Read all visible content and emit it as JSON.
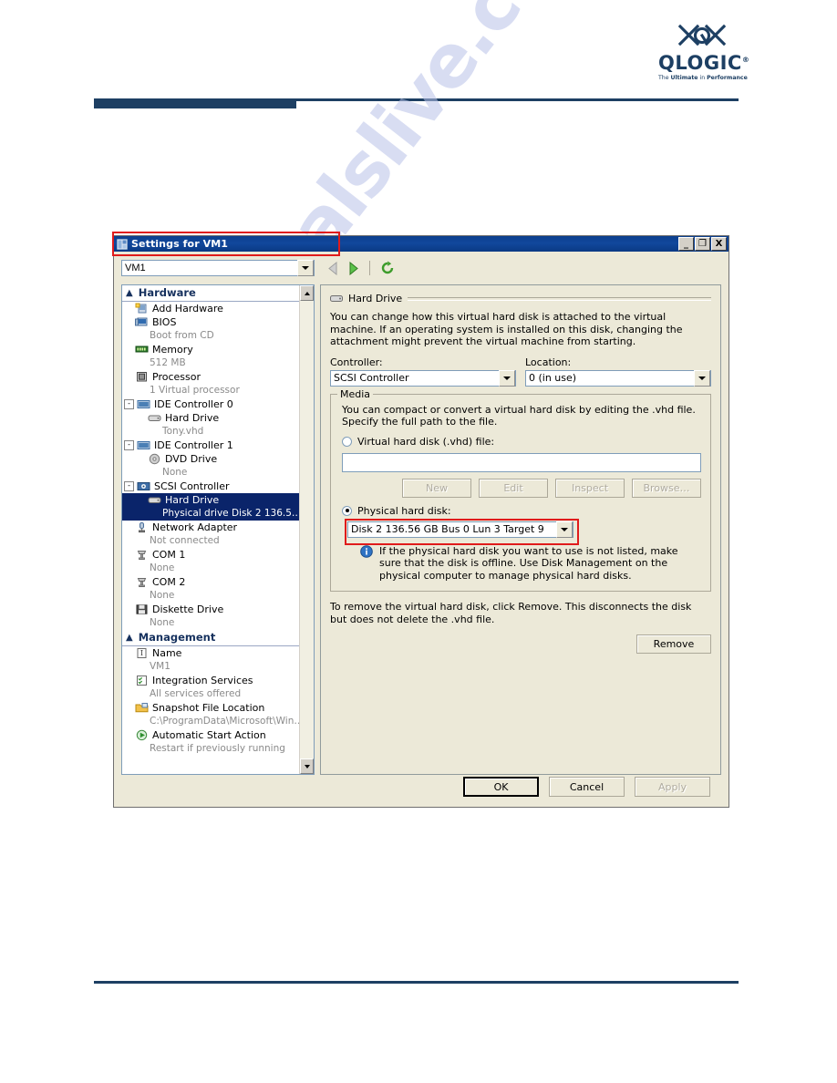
{
  "brand": {
    "logo_name": "qlogic-logo",
    "wordmark": "QLOGIC",
    "registered": "®",
    "tagline_pre": "The",
    "tagline_bold": "Ultimate",
    "tagline_mid": "in",
    "tagline_bold2": "Performance",
    "accent_color": "#1d3f63"
  },
  "watermark": {
    "text": "manualslive.com",
    "color": "#b9c2e8"
  },
  "dialog": {
    "title": "Settings for VM1",
    "window_buttons": [
      {
        "name": "minimize-button",
        "glyph": "_"
      },
      {
        "name": "maximize-button",
        "glyph": "❐"
      },
      {
        "name": "close-button",
        "glyph": "X"
      }
    ],
    "vm_selector": {
      "value": "VM1"
    },
    "toolbar": {
      "back_icon": "back-arrow-icon",
      "forward_icon": "forward-arrow-icon",
      "refresh_icon": "refresh-icon"
    }
  },
  "tree": {
    "groups": [
      {
        "label": "Hardware",
        "nodes": [
          {
            "icon": "add-hardware-icon",
            "label": "Add Hardware",
            "sub": null,
            "expander": null,
            "indent": false,
            "selected": false
          },
          {
            "icon": "bios-icon",
            "label": "BIOS",
            "sub": "Boot from CD",
            "expander": null,
            "indent": false,
            "selected": false
          },
          {
            "icon": "memory-icon",
            "label": "Memory",
            "sub": "512 MB",
            "expander": null,
            "indent": false,
            "selected": false
          },
          {
            "icon": "processor-icon",
            "label": "Processor",
            "sub": "1 Virtual processor",
            "expander": null,
            "indent": false,
            "selected": false
          },
          {
            "icon": "ide-controller-icon",
            "label": "IDE Controller 0",
            "sub": null,
            "expander": "-",
            "indent": false,
            "selected": false
          },
          {
            "icon": "hard-drive-icon",
            "label": "Hard Drive",
            "sub": "Tony.vhd",
            "expander": null,
            "indent": true,
            "selected": false
          },
          {
            "icon": "ide-controller-icon",
            "label": "IDE Controller 1",
            "sub": null,
            "expander": "-",
            "indent": false,
            "selected": false
          },
          {
            "icon": "dvd-drive-icon",
            "label": "DVD Drive",
            "sub": "None",
            "expander": null,
            "indent": true,
            "selected": false
          },
          {
            "icon": "scsi-controller-icon",
            "label": "SCSI Controller",
            "sub": null,
            "expander": "-",
            "indent": false,
            "selected": false
          },
          {
            "icon": "hard-drive-icon",
            "label": "Hard Drive",
            "sub": "Physical drive Disk 2 136.5…",
            "expander": null,
            "indent": true,
            "selected": true
          },
          {
            "icon": "network-adapter-icon",
            "label": "Network Adapter",
            "sub": "Not connected",
            "expander": null,
            "indent": false,
            "selected": false
          },
          {
            "icon": "com-port-icon",
            "label": "COM 1",
            "sub": "None",
            "expander": null,
            "indent": false,
            "selected": false
          },
          {
            "icon": "com-port-icon",
            "label": "COM 2",
            "sub": "None",
            "expander": null,
            "indent": false,
            "selected": false
          },
          {
            "icon": "diskette-drive-icon",
            "label": "Diskette Drive",
            "sub": "None",
            "expander": null,
            "indent": false,
            "selected": false
          }
        ]
      },
      {
        "label": "Management",
        "nodes": [
          {
            "icon": "name-icon",
            "label": "Name",
            "sub": "VM1",
            "expander": null,
            "indent": false,
            "selected": false
          },
          {
            "icon": "integration-services-icon",
            "label": "Integration Services",
            "sub": "All services offered",
            "expander": null,
            "indent": false,
            "selected": false
          },
          {
            "icon": "snapshot-folder-icon",
            "label": "Snapshot File Location",
            "sub": "C:\\ProgramData\\Microsoft\\Win…",
            "expander": null,
            "indent": false,
            "selected": false
          },
          {
            "icon": "automatic-start-icon",
            "label": "Automatic Start Action",
            "sub": "Restart if previously running",
            "expander": null,
            "indent": false,
            "selected": false
          }
        ]
      }
    ]
  },
  "detail": {
    "section_title": "Hard Drive",
    "section_icon": "hard-drive-icon",
    "intro": "You can change how this virtual hard disk is attached to the virtual machine. If an operating system is installed on this disk, changing the attachment might prevent the virtual machine from starting.",
    "controller_label": "Controller:",
    "controller_value": "SCSI Controller",
    "location_label": "Location:",
    "location_value": "0 (in use)",
    "media": {
      "title": "Media",
      "description": "You can compact or convert a virtual hard disk by editing the .vhd file. Specify the full path to the file.",
      "vhd_radio_label": "Virtual hard disk (.vhd) file:",
      "vhd_selected": false,
      "vhd_path_value": "",
      "buttons": [
        {
          "name": "new-button",
          "label": "New",
          "disabled": true
        },
        {
          "name": "edit-button",
          "label": "Edit",
          "disabled": true
        },
        {
          "name": "inspect-button",
          "label": "Inspect",
          "disabled": true
        },
        {
          "name": "browse-button",
          "label": "Browse…",
          "disabled": true
        }
      ],
      "physical_radio_label": "Physical hard disk:",
      "physical_selected": true,
      "physical_disk_value": "Disk 2 136.56 GB Bus 0 Lun 3 Target 9",
      "info_icon": "info-icon",
      "info_text": "If the physical hard disk you want to use is not listed, make sure that the disk is offline. Use Disk Management on the physical computer to manage physical hard disks."
    },
    "remove_note": "To remove the virtual hard disk, click Remove. This disconnects the disk but does not delete the .vhd file.",
    "remove_button": "Remove"
  },
  "actions": [
    {
      "name": "ok-button",
      "label": "OK",
      "disabled": false,
      "default": true
    },
    {
      "name": "cancel-button",
      "label": "Cancel",
      "disabled": false,
      "default": false
    },
    {
      "name": "apply-button",
      "label": "Apply",
      "disabled": true,
      "default": false
    }
  ],
  "annotations": [
    {
      "name": "annotation-title-highlight",
      "color": "#e01b1b"
    },
    {
      "name": "annotation-disk-highlight",
      "color": "#e01b1b"
    }
  ]
}
